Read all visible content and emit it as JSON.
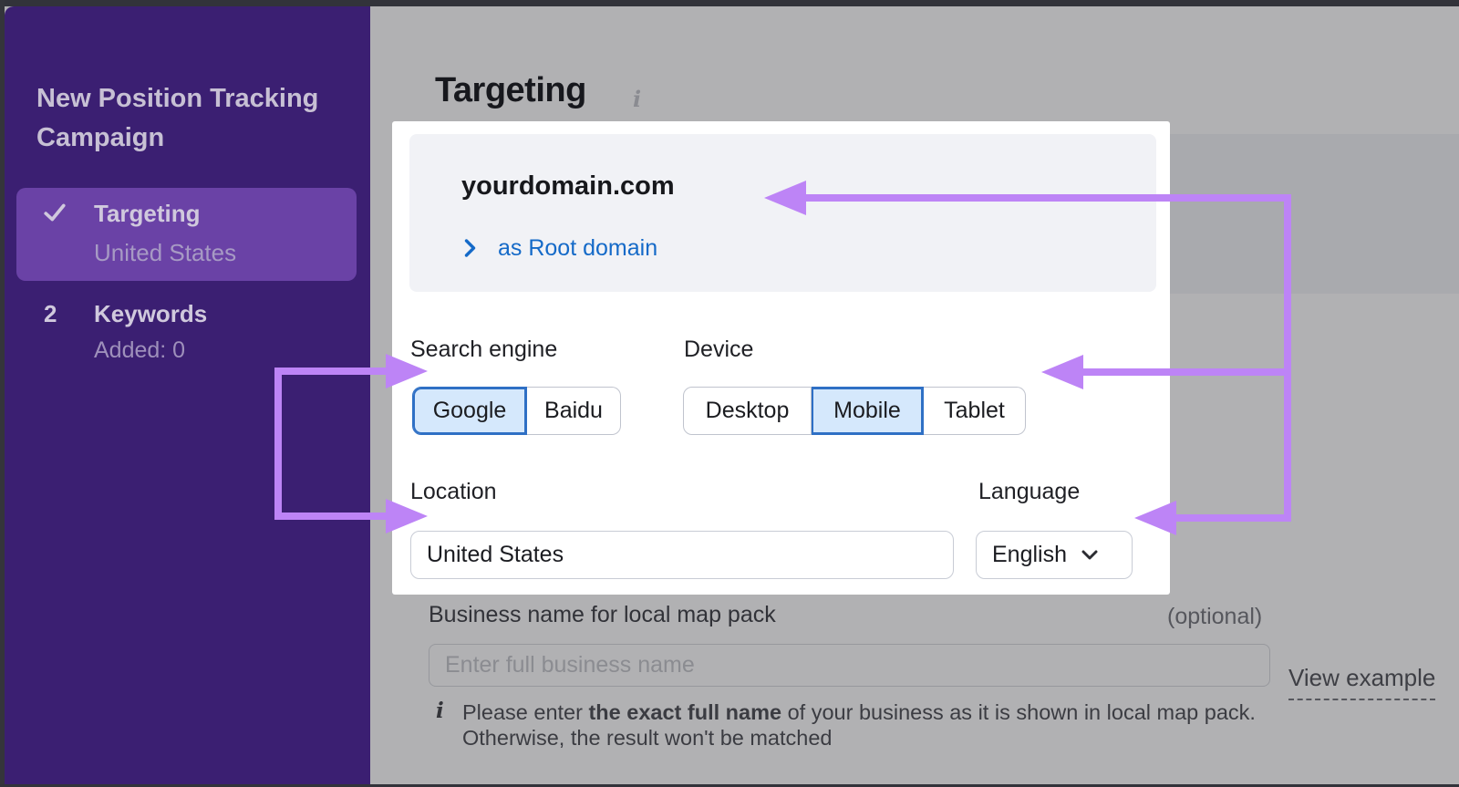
{
  "sidebar": {
    "title": "New Position Tracking Campaign",
    "steps": [
      {
        "label": "Targeting",
        "sublabel": "United States",
        "state": "active-completed"
      },
      {
        "marker": "2",
        "label": "Keywords",
        "sublabel": "Added: 0",
        "state": "upcoming"
      }
    ]
  },
  "main": {
    "heading": "Targeting",
    "heading_info": "i",
    "domain": {
      "name": "yourdomain.com",
      "scope": "as Root domain"
    },
    "search_engine": {
      "label": "Search engine",
      "options": [
        "Google",
        "Baidu"
      ],
      "selected": "Google"
    },
    "device": {
      "label": "Device",
      "options": [
        "Desktop",
        "Mobile",
        "Tablet"
      ],
      "selected": "Mobile"
    },
    "location": {
      "label": "Location",
      "value": "United States"
    },
    "language": {
      "label": "Language",
      "value": "English"
    },
    "business": {
      "label": "Business name for local map pack",
      "optional": "(optional)",
      "placeholder": "Enter full business name",
      "view_example": "View example",
      "note_icon": "i",
      "note_prefix": "Please enter ",
      "note_bold": "the exact full name",
      "note_suffix": " of your business as it is shown in local map pack.",
      "note_line2": "Otherwise, the result won't be matched"
    }
  },
  "colors": {
    "frame": "#32333a",
    "sidebar_bg": "#3b1f72",
    "sidebar_active_bg": "#6a42a6",
    "dim_background": "#b1b1b3",
    "dim_band": "#a9aaae",
    "card_bg": "#ffffff",
    "domain_box_bg": "#f1f2f6",
    "link_blue": "#156ac8",
    "segment_selected_fill": "#d5e8fc",
    "segment_selected_border": "#2f70c5",
    "annotation_arrow": "#bd84f6"
  }
}
